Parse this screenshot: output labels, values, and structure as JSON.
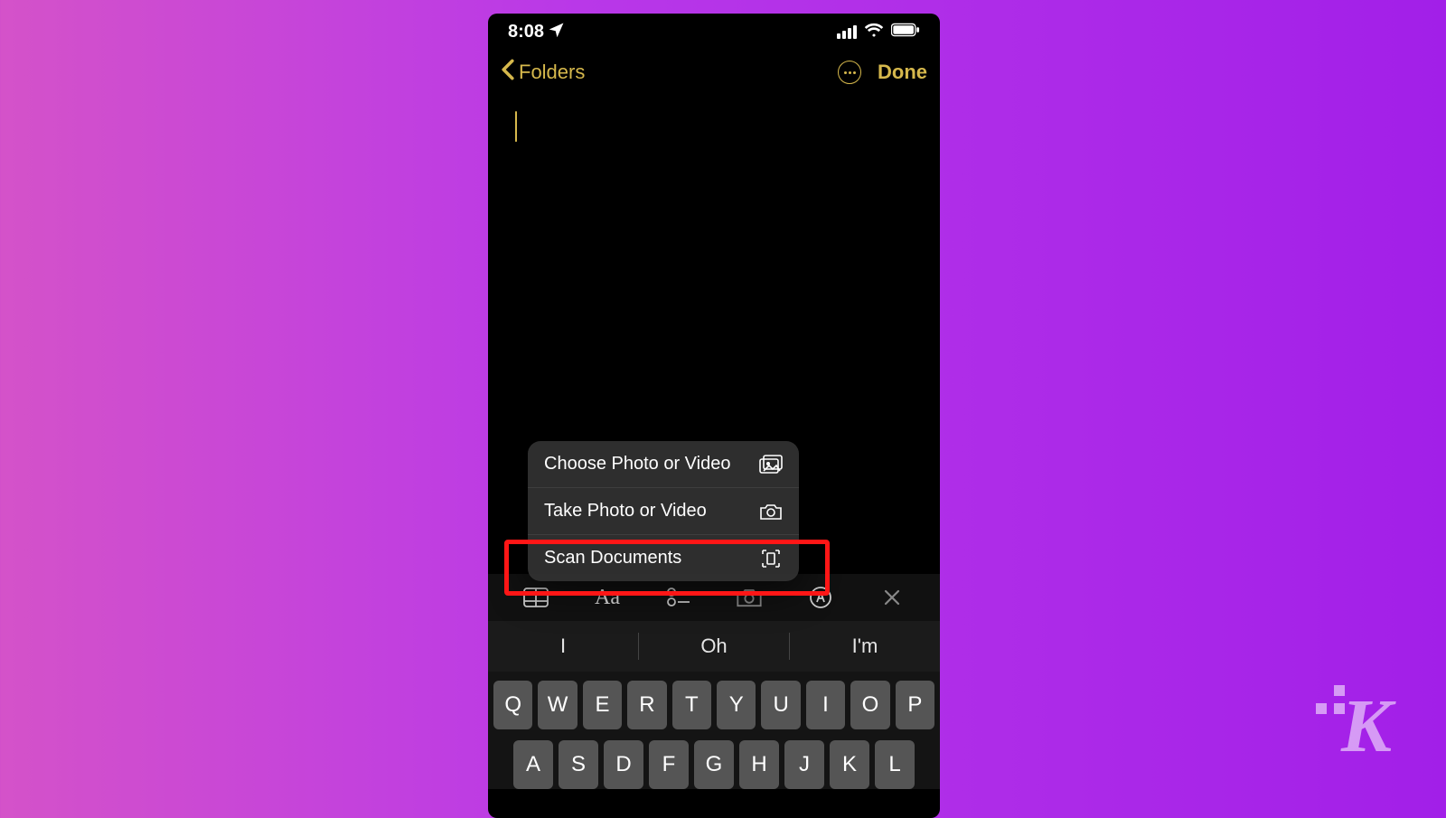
{
  "status": {
    "time": "8:08"
  },
  "nav": {
    "back_label": "Folders",
    "done_label": "Done"
  },
  "menu": {
    "items": [
      {
        "label": "Choose Photo or Video",
        "icon": "photo-library-icon"
      },
      {
        "label": "Take Photo or Video",
        "icon": "camera-icon"
      },
      {
        "label": "Scan Documents",
        "icon": "document-scan-icon"
      }
    ],
    "highlighted_index": 2
  },
  "format_bar": {
    "buttons": [
      "table-icon",
      "text-format-icon",
      "checklist-icon",
      "camera-icon",
      "markup-icon",
      "close-icon"
    ]
  },
  "suggestions": [
    "I",
    "Oh",
    "I'm"
  ],
  "keyboard": {
    "row1": [
      "Q",
      "W",
      "E",
      "R",
      "T",
      "Y",
      "U",
      "I",
      "O",
      "P"
    ],
    "row2": [
      "A",
      "S",
      "D",
      "F",
      "G",
      "H",
      "J",
      "K",
      "L"
    ]
  },
  "watermark": {
    "letter": "K"
  }
}
